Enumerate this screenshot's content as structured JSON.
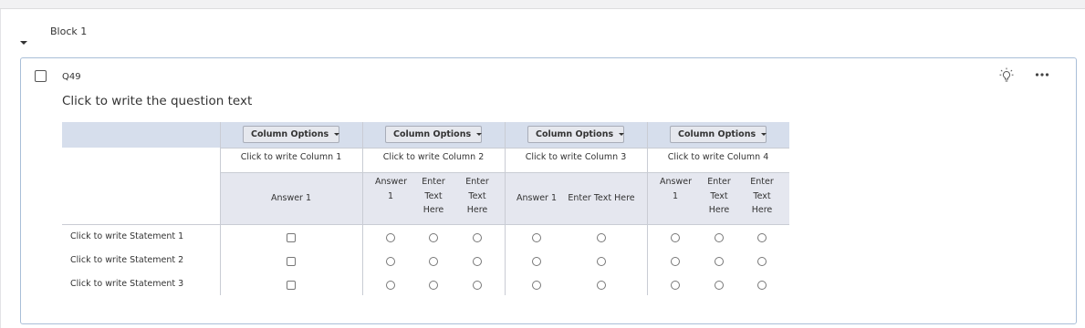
{
  "block": {
    "title": "Block 1"
  },
  "question": {
    "id": "Q49",
    "text": "Click to write the question text",
    "matrix": {
      "columns": [
        {
          "options_label": "Column Options",
          "title": "Click to write Column 1",
          "answers": [
            "Answer 1"
          ]
        },
        {
          "options_label": "Column Options",
          "title": "Click to write Column 2",
          "answers": [
            "Answer 1",
            "Enter Text Here",
            "Enter Text Here"
          ]
        },
        {
          "options_label": "Column Options",
          "title": "Click to write Column 3",
          "answers": [
            "Answer 1",
            "Enter Text Here"
          ]
        },
        {
          "options_label": "Column Options",
          "title": "Click to write Column 4",
          "answers": [
            "Answer 1",
            "Enter Text Here",
            "Enter Text Here"
          ]
        }
      ],
      "statements": [
        "Click to write Statement 1",
        "Click to write Statement 2",
        "Click to write Statement 3"
      ]
    }
  },
  "icons": {
    "collapse": "chevron-down-icon",
    "suggestion": "lightbulb-icon",
    "more": "more-horizontal-icon"
  }
}
